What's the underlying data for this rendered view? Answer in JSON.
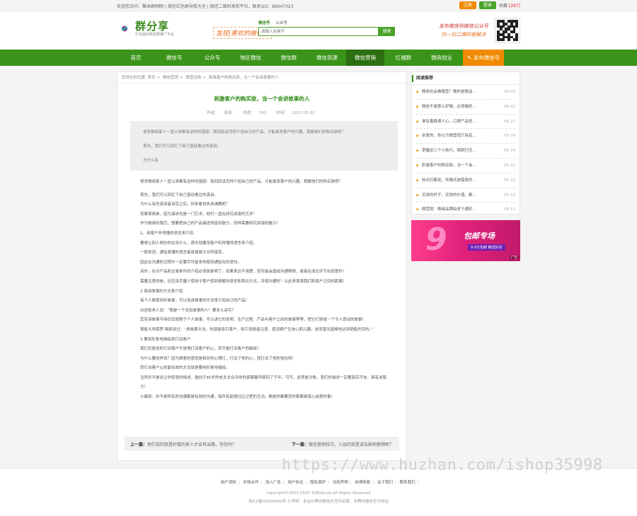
{
  "topbar": {
    "welcome": "欢迎您访问：聚米群网网 | 微信红包群导航大全 | 微信二维码发布平台，联系QQ：88647023",
    "login_label": "注册",
    "register_label": "登录",
    "fav_label": "收藏",
    "fav_count": "[287]",
    "login_color": "#f08a00",
    "register_color": "#4aa32a"
  },
  "header": {
    "logo_title": "群分享",
    "logo_sub": "打造最好微信群推广平台",
    "slogan": "发现|喜欢的微信！",
    "search_tabs": [
      "微信号",
      "公众号"
    ],
    "search_placeholder": "请输入关键字",
    "search_button": "搜索",
    "qr_line1": "发布微信到微信公众号",
    "qr_line2": "扫一扫二维码就解决"
  },
  "nav": {
    "items": [
      "首页",
      "微信号",
      "公众号",
      "地区微信",
      "微信群",
      "微信货源",
      "微信营销",
      "红福群",
      "微商创业"
    ],
    "active_index": 6,
    "publish_label": "发布微信号",
    "accent": "#3a9419",
    "publish_color": "#f08a00"
  },
  "breadcrumb": {
    "prefix": "您现在的位置:",
    "items": [
      "首页",
      "微信营销",
      "微营动态",
      "刺激客户的购买欲，当一个会讲故事的人"
    ]
  },
  "article": {
    "title": "刺激客户的购买欲，当一个会讲故事的人",
    "author_label": "作者：",
    "source_label": "来源：",
    "views_label": "热度：",
    "views": "503",
    "time_label": "时间：",
    "date": "2017-05-22",
    "summary": [
      "很多微商家人一直以来都有这样的困惑：我到底该怎样介绍自己的产品，才能激发客户的兴趣，我都他们的购买欲呢？",
      "首先，我们可以回忆下自己曾经看过的演讲。",
      "为什么有"
    ],
    "paragraphs": [
      "很多微商家人一直以来都有这样的困惑：我到底该怎样介绍自己的产品，才能激发客户的兴趣，我都他们的购买欲呢？",
      "首先，我们可以回忆下自己曾经看过的演讲。",
      "为什么有些演讲者讲完之后，你来看到热血沸腾呢？",
      "答案很简单，因为演讲也是一门艺术，他们一直在研究讲演的艺术！",
      "作为微商的我们，想要把自己的产品描述得富有魅力，同样需要研究讲演的魅力！",
      "1、用客户听得懂的语言来介绍",
      "要想让别人明白你在说什么，首先就要用客户听得懂得语言来介绍。",
      "一般来说，通俗易懂的语言最容易被大众所接受。",
      "因此在沟通的过程中一定要尽可能多的使用通俗化的语句。",
      "另外，在对产品和交易条件的介绍必须简单明了，如果表达不清楚，就可能会造成沟通障碍，或者在成交环节出现意外！",
      "需要注意的是，还应该尽量少使用令客户感到费解的语言和表达方式，并使沟通时！以此来增强我们和客户之间的距离！",
      "2 用讲故事的方式来介绍",
      "每个人都喜欢听故事，可以用讲故事的方法来介绍自己的产品！",
      "白岩松老人说：“我是一个没有故事的人！要多么讲究？",
      "其实讲故事不用仅仅局限于个人故事，可以讲它的发明、生产过程、产品与客户之间的故事等等，把它们穿成一个令人感动的故事！",
      "销售大师保罗·梅耶说过：“用故事方法，你就能吸引客户，吸引消费者注意，使消费产生信心和兴趣，进而毫无困难地达到销售的目的。”",
      "3 要用形象地描绘来打动客户",
      "我们总是说的打动客户不是情打动客户的心，而不是打动客户的脑袋！",
      "为什么要这样说？因为顾客的感觉是相对的心情打，打动了他的心，就打动了他的钱包呀！",
      "而打动客户心的最有效的方法就是要用形象地描绘。",
      "当然并不是说让你夸张的描述，独创于80岁的老太太在寺你的家都酸辛疑到了千年，可可，这项是对象，我们的描述一定要真实可信，具有说服力！",
      "小编说：并不是所有的沟通都是有效的沟通，每件有助提社区过把的互动，都是你都要而时都要是真心诚意的事！"
    ],
    "prev_label": "上一篇：",
    "prev_title": "他们说的就是好看的男人才会有出路，你信吗？",
    "next_label": "下一篇：",
    "next_title": "微信营销技巧，人品的我是讲会影响营销呢？"
  },
  "sidebar": {
    "heading": "阅读推荐",
    "items": [
      {
        "title": "微商也会做微营？做的是微话...",
        "date": "06-06"
      },
      {
        "title": "微信不是那么好做，必须做好...",
        "date": "06-02"
      },
      {
        "title": "谁有着颇诱人心，口碑产品的...",
        "date": "05-27"
      },
      {
        "title": "亲爱的，你以为微营销只有起...",
        "date": "05-24"
      },
      {
        "title": "掌握这三个小技巧，陷阱打压...",
        "date": "05-24"
      },
      {
        "title": "刺激客户的购买欲，当一个会...",
        "date": "05-22"
      },
      {
        "title": "热点们都说，传输式被需真的...",
        "date": "05-22"
      },
      {
        "title": "买饼的杯子，买饼的价值，都...",
        "date": "05-19"
      },
      {
        "title": "微营销：微商品牌由进下通好...",
        "date": "05-12"
      }
    ]
  },
  "ad": {
    "big": "9",
    "title": "包邮专场",
    "sub": "9.9元包邮 精选好货",
    "tag": "广告"
  },
  "footer": {
    "links": [
      "用户须知",
      "市场合作",
      "加入广告",
      "用户协议",
      "隐私保护",
      "法权声明",
      "自律条款",
      "关于我们",
      "联系我们"
    ],
    "copyright": "copyright©2003-2020 108jtdl.vip All Rights Reserved",
    "icp": "粤ICP备00000000号-3  声明：本站与腾讯微信无任何关联，非腾讯微信官方网站"
  },
  "watermark": "https://www.huzhan.com/ishop35998"
}
